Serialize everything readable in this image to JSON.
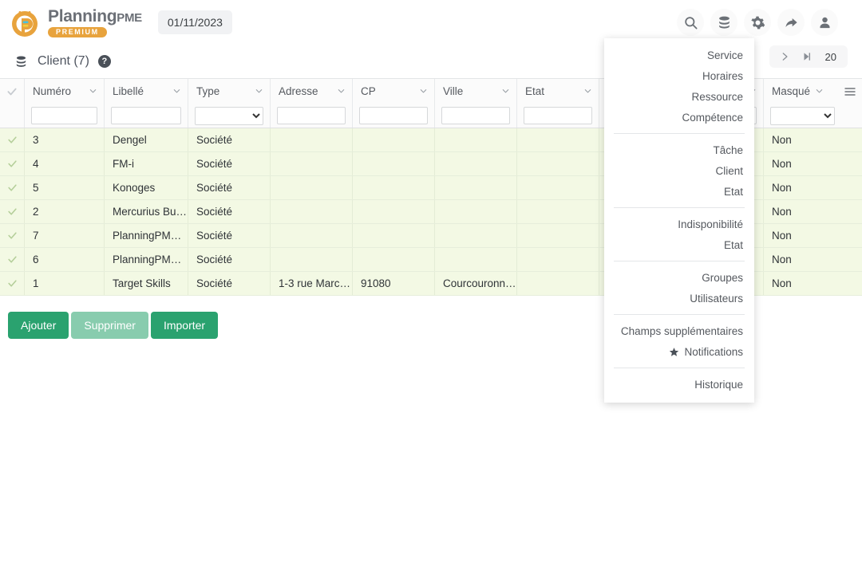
{
  "header": {
    "logo_title": "Planning",
    "logo_title_suffix": "PME",
    "logo_badge": "PREMIUM",
    "date_value": "01/11/2023",
    "icons": [
      "search-icon",
      "database-icon",
      "gear-icon",
      "share-icon",
      "user-icon"
    ]
  },
  "titlebar": {
    "page_title": "Client (7)",
    "help_label": "?",
    "pager": {
      "page_size": "20"
    }
  },
  "table": {
    "columns": [
      {
        "key": "numero",
        "label": "Numéro",
        "filter_type": "text"
      },
      {
        "key": "libelle",
        "label": "Libellé",
        "filter_type": "text"
      },
      {
        "key": "type",
        "label": "Type",
        "filter_type": "select",
        "filter_value": ""
      },
      {
        "key": "adresse",
        "label": "Adresse",
        "filter_type": "text"
      },
      {
        "key": "cp",
        "label": "CP",
        "filter_type": "text"
      },
      {
        "key": "ville",
        "label": "Ville",
        "filter_type": "text"
      },
      {
        "key": "etat",
        "label": "Etat",
        "filter_type": "text"
      },
      {
        "key": "col8",
        "label": "",
        "filter_type": "text"
      },
      {
        "key": "col9",
        "label": "",
        "filter_type": "text"
      },
      {
        "key": "masque",
        "label": "Masqué",
        "filter_type": "select",
        "filter_value": ""
      }
    ],
    "rows": [
      {
        "numero": "3",
        "libelle": "Dengel",
        "type": "Société",
        "adresse": "",
        "cp": "",
        "ville": "",
        "etat": "",
        "col8": "",
        "col9": "",
        "masque": "Non"
      },
      {
        "numero": "4",
        "libelle": "FM-i",
        "type": "Société",
        "adresse": "",
        "cp": "",
        "ville": "",
        "etat": "",
        "col8": "",
        "col9": "",
        "masque": "Non"
      },
      {
        "numero": "5",
        "libelle": "Konoges",
        "type": "Société",
        "adresse": "",
        "cp": "",
        "ville": "",
        "etat": "",
        "col8": "",
        "col9": "",
        "masque": "Non"
      },
      {
        "numero": "2",
        "libelle": "Mercurius Bu…",
        "type": "Société",
        "adresse": "",
        "cp": "",
        "ville": "",
        "etat": "",
        "col8": "",
        "col9": "",
        "masque": "Non"
      },
      {
        "numero": "7",
        "libelle": "PlanningPME…",
        "type": "Société",
        "adresse": "",
        "cp": "",
        "ville": "",
        "etat": "",
        "col8": "",
        "col9": "",
        "masque": "Non"
      },
      {
        "numero": "6",
        "libelle": "PlanningPME…",
        "type": "Société",
        "adresse": "",
        "cp": "",
        "ville": "",
        "etat": "",
        "col8": "",
        "col9": "",
        "masque": "Non"
      },
      {
        "numero": "1",
        "libelle": "Target Skills",
        "type": "Société",
        "adresse": "1-3 rue Marc…",
        "cp": "91080",
        "ville": "Courcouronn…",
        "etat": "",
        "col8": "",
        "col9": "",
        "masque": "Non"
      }
    ]
  },
  "actions": {
    "add_label": "Ajouter",
    "delete_label": "Supprimer",
    "import_label": "Importer"
  },
  "menu": {
    "groups": [
      {
        "items": [
          {
            "label": "Service"
          },
          {
            "label": "Horaires"
          },
          {
            "label": "Ressource"
          },
          {
            "label": "Compétence"
          }
        ]
      },
      {
        "items": [
          {
            "label": "Tâche"
          },
          {
            "label": "Client"
          },
          {
            "label": "Etat"
          }
        ]
      },
      {
        "items": [
          {
            "label": "Indisponibilité"
          },
          {
            "label": "Etat"
          }
        ]
      },
      {
        "items": [
          {
            "label": "Groupes"
          },
          {
            "label": "Utilisateurs"
          }
        ]
      },
      {
        "items": [
          {
            "label": "Champs supplémentaires"
          },
          {
            "label": "Notifications",
            "icon": "star-icon"
          }
        ]
      },
      {
        "items": [
          {
            "label": "Historique"
          }
        ]
      }
    ]
  },
  "colors": {
    "accent_green": "#2aa26f",
    "row_green": "#f3f9e4",
    "logo_orange": "#e8a33d",
    "text_gray": "#55595f"
  }
}
